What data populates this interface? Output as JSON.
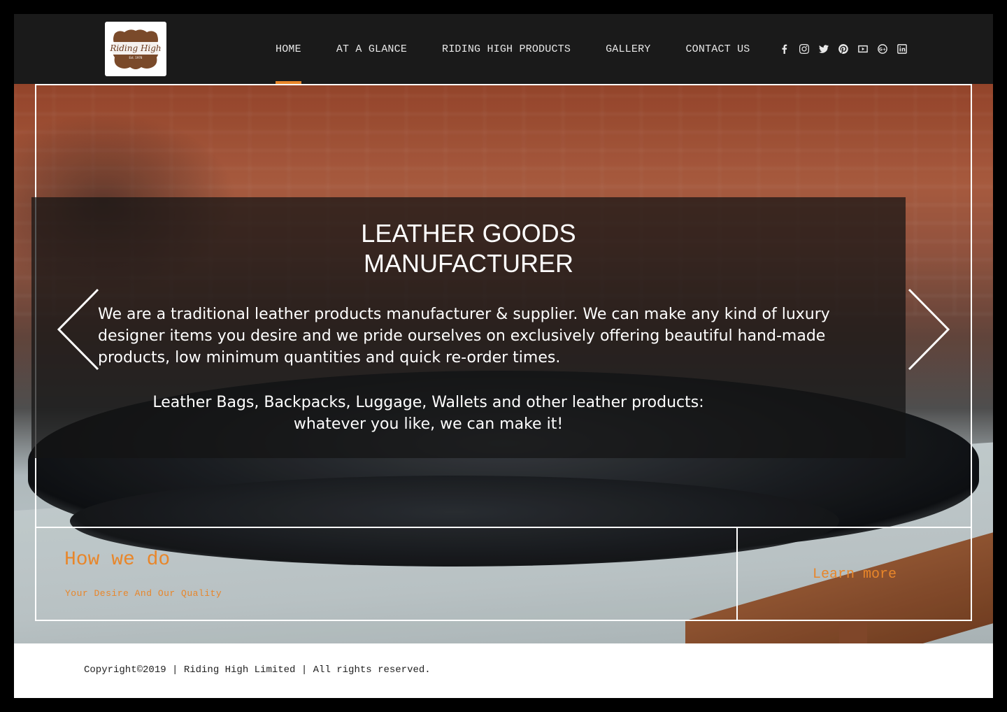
{
  "header": {
    "logo_text": "Riding High",
    "logo_subtext": "Est. 1978",
    "nav": [
      {
        "label": "HOME",
        "active": true
      },
      {
        "label": "AT A GLANCE",
        "active": false
      },
      {
        "label": "RIDING HIGH PRODUCTS",
        "active": false
      },
      {
        "label": "GALLERY",
        "active": false
      },
      {
        "label": "CONTACT US",
        "active": false
      }
    ],
    "social_icons": [
      "facebook-icon",
      "instagram-icon",
      "twitter-icon",
      "pinterest-icon",
      "youtube-icon",
      "google-plus-icon",
      "linkedin-icon"
    ]
  },
  "hero": {
    "title_line1": "LEATHER GOODS",
    "title_line2": "MANUFACTURER",
    "body": "We are a traditional leather products manufacturer & supplier. We can make any kind of luxury designer items you desire and we pride ourselves on exclusively offering beautiful hand-made products, low minimum quantities and quick re-order times.",
    "list_line1": "Leather Bags, Backpacks, Luggage, Wallets and other leather products:",
    "list_line2": "whatever you like, we can make it!"
  },
  "info": {
    "title": "How we do",
    "subtitle": "Your Desire And Our Quality",
    "learn_more": "Learn more"
  },
  "footer": {
    "copyright": "Copyright©2019 | Riding High Limited | All rights reserved."
  },
  "colors": {
    "accent": "#e8862a",
    "header_bg": "#1a1a1a"
  }
}
